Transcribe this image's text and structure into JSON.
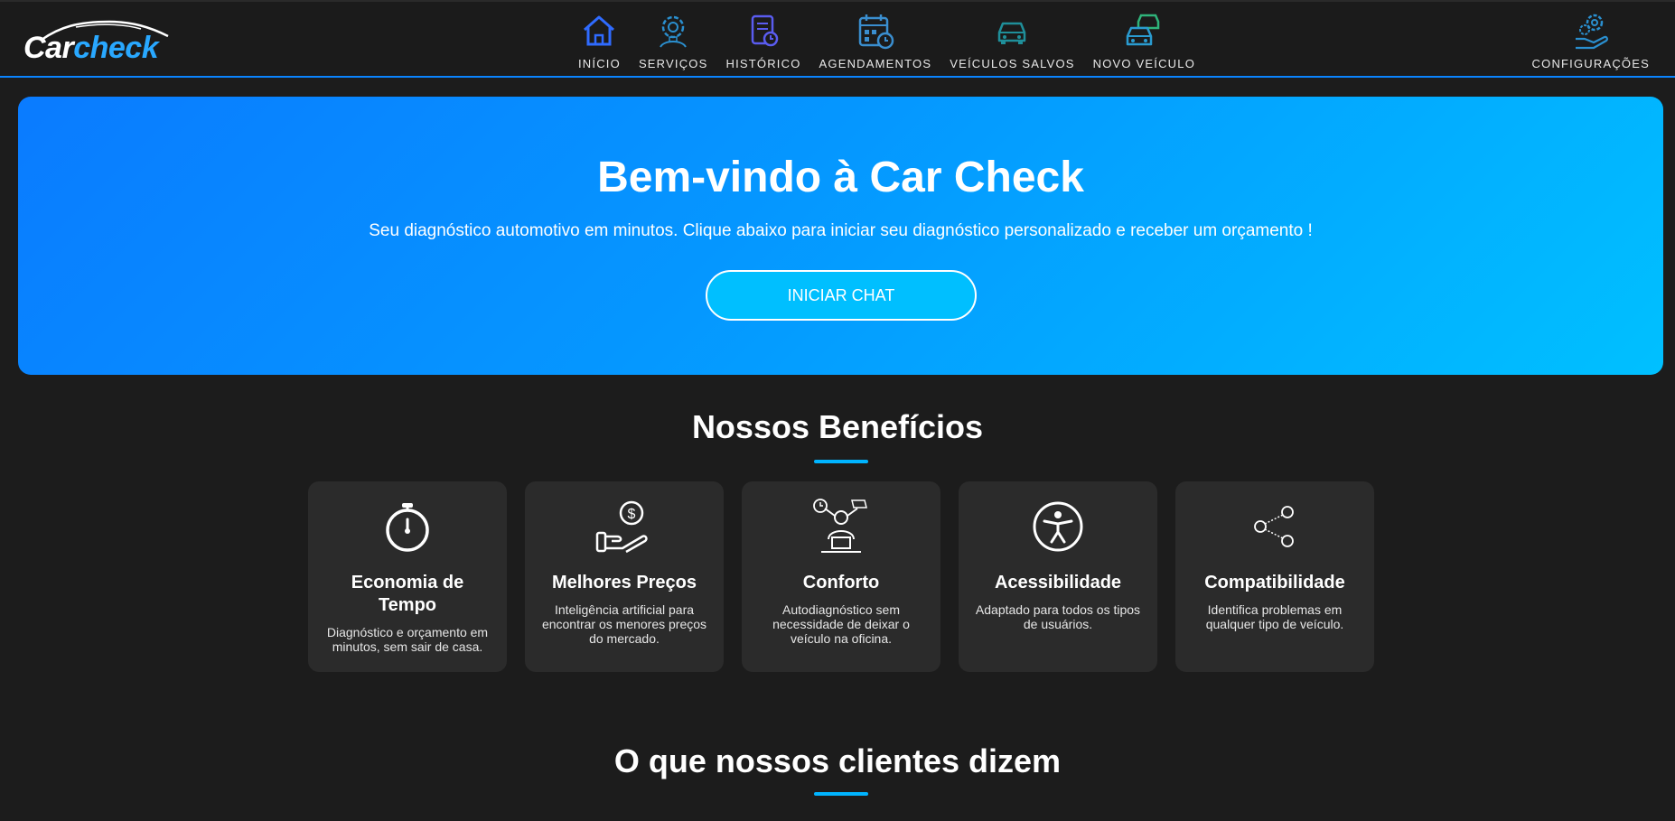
{
  "logo": {
    "car": "Car",
    "check": "check"
  },
  "nav": {
    "items": [
      {
        "label": "INÍCIO",
        "icon": "home-icon"
      },
      {
        "label": "SERVIÇOS",
        "icon": "service-gear-icon"
      },
      {
        "label": "HISTÓRICO",
        "icon": "history-document-icon"
      },
      {
        "label": "AGENDAMENTOS",
        "icon": "calendar-clock-icon"
      },
      {
        "label": "VEÍCULOS SALVOS",
        "icon": "saved-car-icon"
      },
      {
        "label": "NOVO VEÍCULO",
        "icon": "add-vehicle-icon"
      }
    ],
    "config": {
      "label": "CONFIGURAÇÕES",
      "icon": "settings-gears-hand-icon"
    }
  },
  "hero": {
    "title": "Bem-vindo à Car Check",
    "subtitle": "Seu diagnóstico automotivo em minutos. Clique abaixo para iniciar seu diagnóstico personalizado e receber um orçamento !",
    "button": "INICIAR CHAT"
  },
  "benefits": {
    "title": "Nossos Benefícios",
    "cards": [
      {
        "title": "Economia de Tempo",
        "desc": "Diagnóstico e orçamento em minutos, sem sair de casa.",
        "icon": "stopwatch-icon"
      },
      {
        "title": "Melhores Preços",
        "desc": "Inteligência artificial para encontrar os menores preços do mercado.",
        "icon": "hand-money-icon"
      },
      {
        "title": "Conforto",
        "desc": "Autodiagnóstico sem necessidade de deixar o veículo na oficina.",
        "icon": "relaxed-person-laptop-icon"
      },
      {
        "title": "Acessibilidade",
        "desc": "Adaptado para todos os tipos de usuários.",
        "icon": "accessibility-icon"
      },
      {
        "title": "Compatibilidade",
        "desc": "Identifica problemas em qualquer tipo de veículo.",
        "icon": "share-network-icon"
      }
    ]
  },
  "testimonials": {
    "title": "O que nossos clientes dizem"
  },
  "colors": {
    "accent": "#00b4ff",
    "nav_border": "#0a84ff",
    "card_bg": "#2b2b2b",
    "page_bg": "#1c1c1c"
  }
}
